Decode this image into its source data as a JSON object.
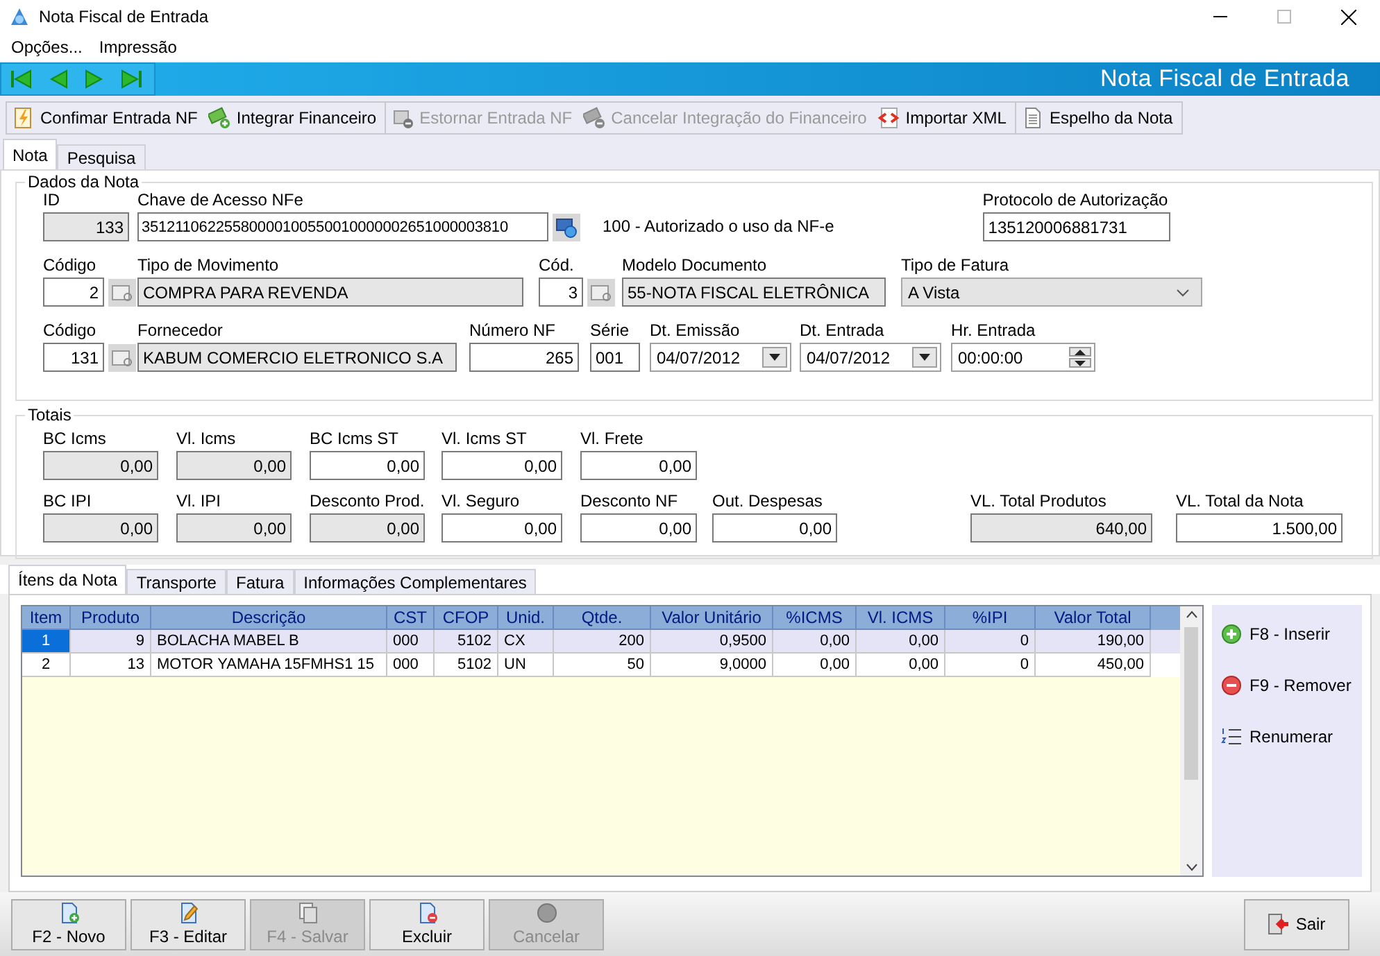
{
  "window": {
    "title": "Nota Fiscal de Entrada"
  },
  "menu": [
    "Opções...",
    "Impressão"
  ],
  "header": {
    "title": "Nota Fiscal de Entrada"
  },
  "toolbar": [
    {
      "kind": "confirm",
      "label": "Confimar Entrada NF",
      "disabled": false
    },
    {
      "kind": "money_add",
      "label": "Integrar Financeiro",
      "disabled": false
    },
    {
      "kind": "doc_remove",
      "label": "Estornar Entrada NF",
      "disabled": true
    },
    {
      "kind": "money_remove",
      "label": "Cancelar Integração do Financeiro",
      "disabled": true
    },
    {
      "kind": "xml",
      "label": "Importar XML",
      "disabled": false
    },
    {
      "kind": "document",
      "label": "Espelho da Nota",
      "disabled": false
    }
  ],
  "tabs": [
    {
      "label": "Nota",
      "selected": true
    },
    {
      "label": "Pesquisa",
      "selected": false
    }
  ],
  "dados": {
    "title": "Dados da Nota",
    "id": {
      "label": "ID",
      "value": "133",
      "readonly": true
    },
    "chave_acesso": {
      "label": "Chave de Acesso NFe",
      "value": "35121106225580000100550010000002651000003810",
      "readonly": false
    },
    "status": "100 - Autorizado o uso da NF-e",
    "protocolo": {
      "label": "Protocolo de Autorização",
      "value": "135120006881731",
      "readonly": false
    },
    "codigo_movimento": {
      "label": "Código",
      "value": "2",
      "readonly": false
    },
    "tipo_movimento": {
      "label": "Tipo de Movimento",
      "value": "COMPRA PARA REVENDA",
      "readonly": true
    },
    "codigo_modelo": {
      "label": "Cód.",
      "value": "3",
      "readonly": false
    },
    "modelo_documento": {
      "label": "Modelo Documento",
      "value": "55-NOTA FISCAL ELETRÔNICA",
      "readonly": true
    },
    "tipo_fatura": {
      "label": "Tipo de Fatura",
      "value": "A Vista",
      "readonly": true
    },
    "codigo_fornecedor": {
      "label": "Código",
      "value": "131",
      "readonly": false
    },
    "fornecedor": {
      "label": "Fornecedor",
      "value": "KABUM COMERCIO ELETRONICO S.A",
      "readonly": true
    },
    "numero_nf": {
      "label": "Número NF",
      "value": "265",
      "readonly": false
    },
    "serie": {
      "label": "Série",
      "value": "001",
      "readonly": false
    },
    "dt_emissao": {
      "label": "Dt. Emissão",
      "value": "04/07/2012",
      "readonly": false
    },
    "dt_entrada": {
      "label": "Dt. Entrada",
      "value": "04/07/2012",
      "readonly": false
    },
    "hr_entrada": {
      "label": "Hr. Entrada",
      "value": "00:00:00",
      "readonly": false
    }
  },
  "totais": {
    "title": "Totais",
    "rows": [
      [
        {
          "label": "BC Icms",
          "value": "0,00",
          "readonly": true
        },
        {
          "label": "Vl. Icms",
          "value": "0,00",
          "readonly": true
        },
        {
          "label": "BC Icms ST",
          "value": "0,00",
          "readonly": false
        },
        {
          "label": "Vl. Icms ST",
          "value": "0,00",
          "readonly": false
        },
        {
          "label": "Vl. Frete",
          "value": "0,00",
          "readonly": false
        }
      ],
      [
        {
          "label": "BC IPI",
          "value": "0,00",
          "readonly": true
        },
        {
          "label": "Vl. IPI",
          "value": "0,00",
          "readonly": true
        },
        {
          "label": "Desconto Prod.",
          "value": "0,00",
          "readonly": true
        },
        {
          "label": "Vl. Seguro",
          "value": "0,00",
          "readonly": false
        },
        {
          "label": "Desconto NF",
          "value": "0,00",
          "readonly": false
        },
        {
          "label": "Out. Despesas",
          "value": "0,00",
          "readonly": false
        },
        {
          "label": "VL. Total Produtos",
          "value": "640,00",
          "readonly": true
        },
        {
          "label": "VL. Total da Nota",
          "value": "1.500,00",
          "readonly": false
        }
      ]
    ]
  },
  "item_tabs": [
    {
      "label": "Ítens da Nota",
      "selected": true
    },
    {
      "label": "Transporte",
      "selected": false
    },
    {
      "label": "Fatura",
      "selected": false
    },
    {
      "label": "Informações Complementares",
      "selected": false
    }
  ],
  "grid": {
    "columns": [
      "Item",
      "Produto",
      "Descrição",
      "CST",
      "CFOP",
      "Unid.",
      "Qtde.",
      "Valor Unitário",
      "%ICMS",
      "Vl. ICMS",
      "%IPI",
      "Valor Total"
    ],
    "rows": [
      {
        "selected": true,
        "cells": [
          "1",
          "9",
          "BOLACHA MABEL B",
          "000",
          "5102",
          "CX",
          "200",
          "0,9500",
          "0,00",
          "0,00",
          "0",
          "190,00"
        ]
      },
      {
        "selected": false,
        "cells": [
          "2",
          "13",
          "MOTOR YAMAHA 15FMHS1 15",
          "000",
          "5102",
          "UN",
          "50",
          "9,0000",
          "0,00",
          "0,00",
          "0",
          "450,00"
        ]
      }
    ]
  },
  "side_actions": [
    {
      "kind": "add",
      "label": "F8 - Inserir"
    },
    {
      "kind": "remove",
      "label": "F9 - Remover"
    },
    {
      "kind": "renumber",
      "label": "Renumerar"
    }
  ],
  "footer_buttons": [
    {
      "kind": "new",
      "label": "F2 - Novo",
      "disabled": false
    },
    {
      "kind": "edit",
      "label": "F3 - Editar",
      "disabled": false
    },
    {
      "kind": "save",
      "label": "F4 - Salvar",
      "disabled": true
    },
    {
      "kind": "delete",
      "label": "Excluir",
      "disabled": false
    },
    {
      "kind": "cancel",
      "label": "Cancelar",
      "disabled": true
    }
  ],
  "exit": {
    "kind": "exit",
    "label": "Sair"
  }
}
